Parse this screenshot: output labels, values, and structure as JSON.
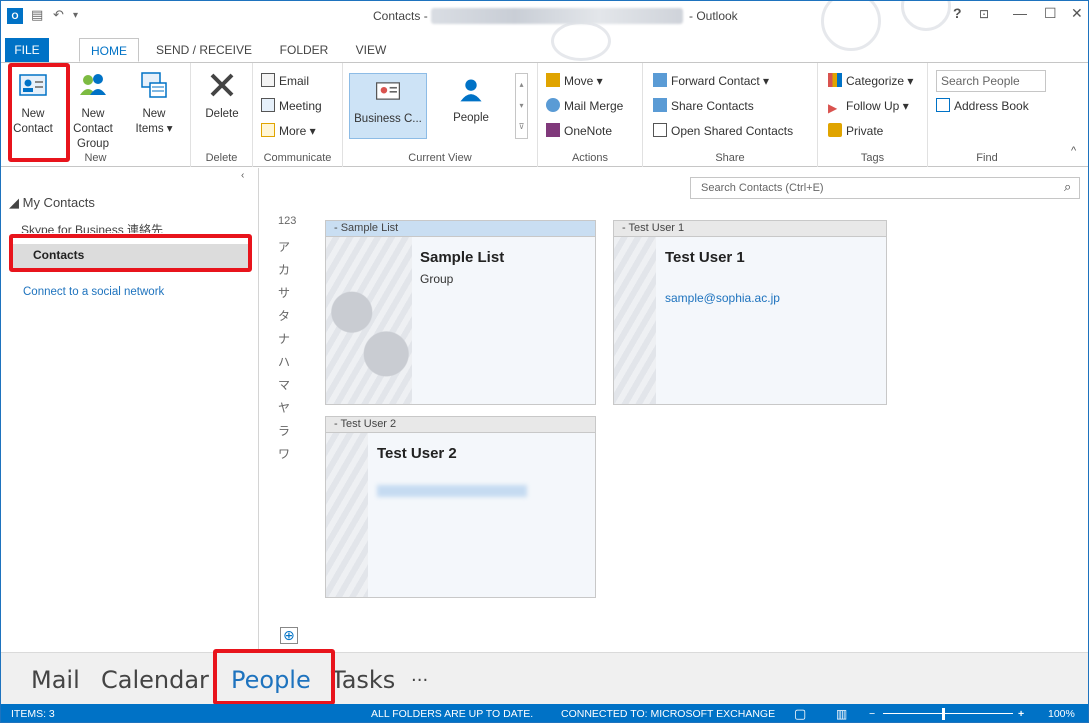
{
  "titlebar": {
    "title": "Contacts -",
    "app": "- Outlook",
    "help": "?",
    "app_icon": "O"
  },
  "tabs": [
    "FILE",
    "HOME",
    "SEND / RECEIVE",
    "FOLDER",
    "VIEW"
  ],
  "ribbon": {
    "new_group": {
      "new_contact": "New Contact",
      "new_contact_group": "New Contact Group",
      "new_items": "New Items",
      "label": "New"
    },
    "delete_group": {
      "delete": "Delete",
      "label": "Delete"
    },
    "communicate": {
      "email": "Email",
      "meeting": "Meeting",
      "more": "More",
      "label": "Communicate"
    },
    "current_view": {
      "business_card": "Business C...",
      "people": "People",
      "label": "Current View"
    },
    "actions": {
      "move": "Move",
      "mail_merge": "Mail Merge",
      "onenote": "OneNote",
      "label": "Actions"
    },
    "share": {
      "forward_contact": "Forward Contact",
      "share_contacts": "Share Contacts",
      "open_shared": "Open Shared Contacts",
      "label": "Share"
    },
    "tags": {
      "categorize": "Categorize",
      "follow_up": "Follow Up",
      "private": "Private",
      "label": "Tags"
    },
    "find": {
      "search_people": "Search People",
      "address_book": "Address Book",
      "label": "Find"
    }
  },
  "leftpane": {
    "header": "My Contacts",
    "items": [
      "Skype for Business 連絡先",
      "Contacts"
    ],
    "social": "Connect to a social network"
  },
  "search": {
    "placeholder": "Search Contacts (Ctrl+E)"
  },
  "alphabet": [
    "123",
    "ア",
    "カ",
    "サ",
    "タ",
    "ナ",
    "ハ",
    "マ",
    "ヤ",
    "ラ",
    "ワ"
  ],
  "cards": [
    {
      "header": "- Sample List",
      "name": "Sample List",
      "sub": "Group"
    },
    {
      "header": "- Test User 1",
      "name": "Test User 1",
      "sub": "sample@sophia.ac.jp"
    },
    {
      "header": "- Test User 2",
      "name": "Test User 2",
      "sub": ""
    }
  ],
  "nav": {
    "mail": "Mail",
    "calendar": "Calendar",
    "people": "People",
    "tasks": "Tasks",
    "more": "···"
  },
  "status": {
    "items": "ITEMS: 3",
    "folders": "ALL FOLDERS ARE UP TO DATE.",
    "connected": "CONNECTED TO: MICROSOFT EXCHANGE",
    "zoom": "100%"
  },
  "colors": {
    "accent": "#0072c6",
    "highlight": "#e8141c"
  }
}
